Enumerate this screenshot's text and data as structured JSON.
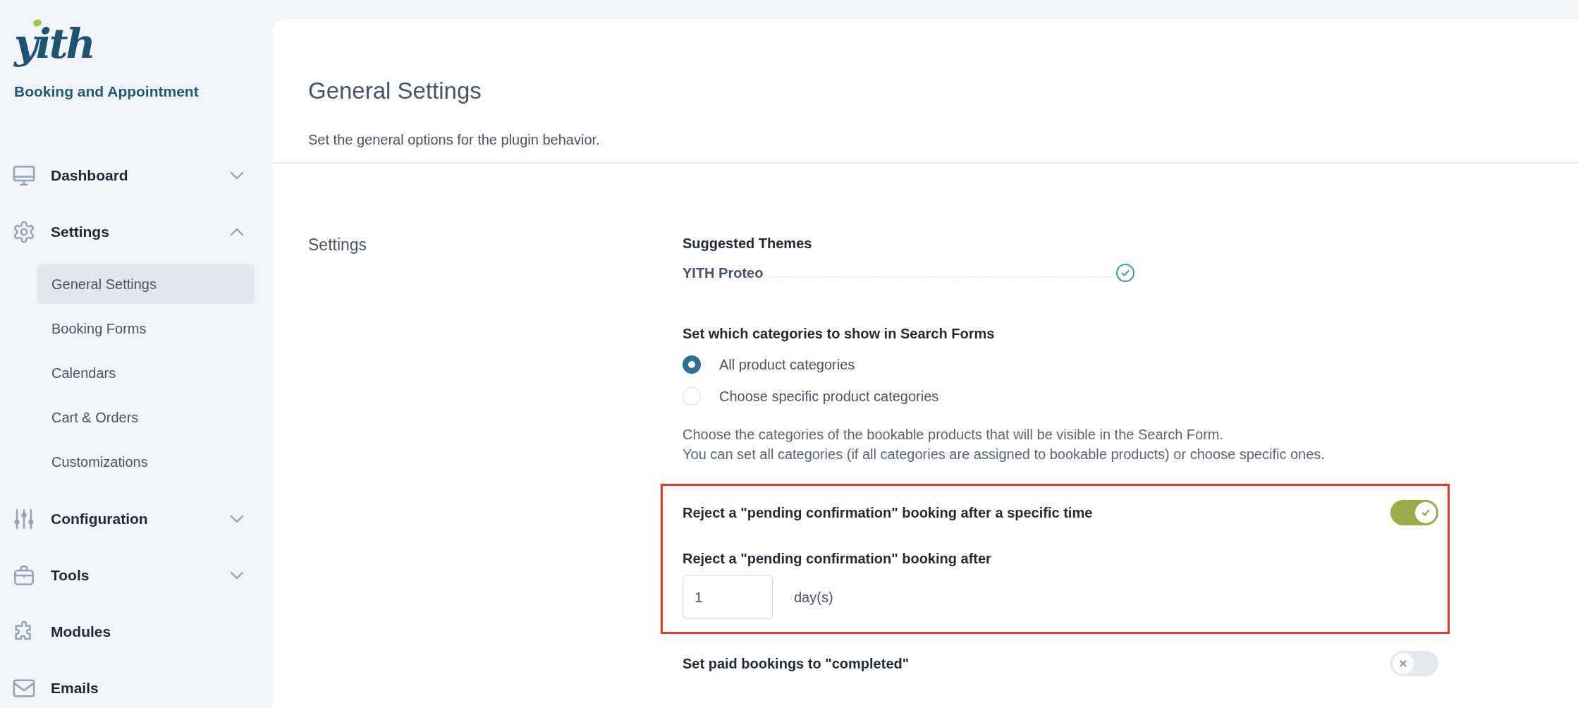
{
  "sidebar": {
    "logo": "yith",
    "product": "Booking and Appointment",
    "items": [
      {
        "label": "Dashboard",
        "kind": "expandable",
        "expanded": false
      },
      {
        "label": "Settings",
        "kind": "expandable",
        "expanded": true,
        "children": [
          {
            "label": "General Settings",
            "selected": true
          },
          {
            "label": "Booking Forms",
            "selected": false
          },
          {
            "label": "Calendars",
            "selected": false
          },
          {
            "label": "Cart & Orders",
            "selected": false
          },
          {
            "label": "Customizations",
            "selected": false
          }
        ]
      },
      {
        "label": "Configuration",
        "kind": "expandable",
        "expanded": false
      },
      {
        "label": "Tools",
        "kind": "expandable",
        "expanded": false
      },
      {
        "label": "Modules",
        "kind": "link"
      },
      {
        "label": "Emails",
        "kind": "link"
      }
    ]
  },
  "page": {
    "title": "General Settings",
    "subtitle": "Set the general options for the plugin behavior."
  },
  "section": {
    "title": "Settings",
    "fields": [
      {
        "kind": "themes",
        "label": "Suggested Themes",
        "themes": [
          {
            "name": "YITH Proteo",
            "installed": true
          }
        ]
      },
      {
        "kind": "radio",
        "label": "Set which categories to show in Search Forms",
        "options": [
          {
            "label": "All product categories",
            "selected": true
          },
          {
            "label": "Choose specific product categories",
            "selected": false
          }
        ],
        "description": [
          "Choose the categories of the bookable products that will be visible in the Search Form.",
          "You can set all categories (if all categories are assigned to bookable products) or choose specific ones."
        ]
      },
      {
        "kind": "toggle",
        "label": "Reject a \"pending confirmation\" booking after a specific time",
        "on": true,
        "highlighted": true
      },
      {
        "kind": "number",
        "label": "Reject a \"pending confirmation\" booking after",
        "value": "1",
        "unit": "day(s)",
        "highlighted": true
      },
      {
        "kind": "toggle",
        "label": "Set paid bookings to \"completed\"",
        "on": false,
        "highlighted": false
      }
    ]
  }
}
